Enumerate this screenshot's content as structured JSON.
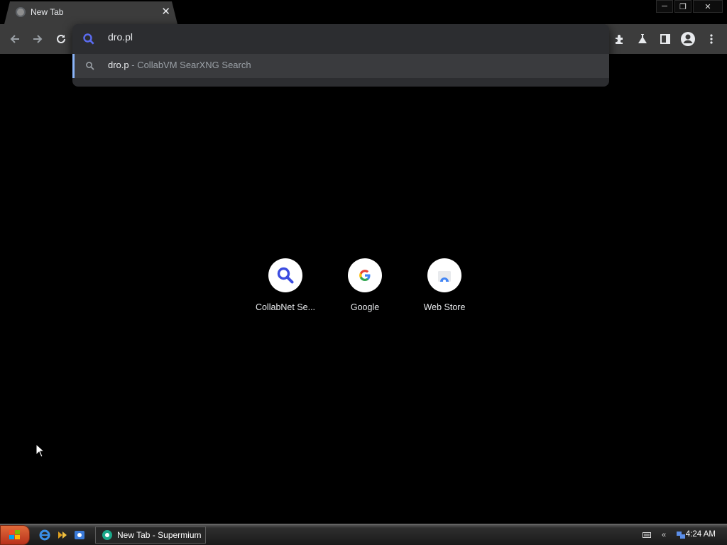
{
  "browser": {
    "tab": {
      "title": "New Tab",
      "close_glyph": "✕",
      "favicon": "globe-icon"
    },
    "window_controls": {
      "minimize": "─",
      "restore": "❐",
      "close": "✕"
    },
    "omnibox": {
      "value": "dro.pl",
      "suggestion": {
        "text": "dro.p",
        "subtext": " - CollabVM SearXNG Search"
      }
    },
    "toolbar_icons": [
      "back-icon",
      "forward-icon",
      "reload-icon",
      "extensions-icon",
      "labs-icon",
      "side-panel-icon",
      "profile-icon",
      "menu-icon"
    ]
  },
  "ntp": {
    "shortcuts": [
      {
        "label": "CollabNet Se...",
        "icon": "search-icon"
      },
      {
        "label": "Google",
        "icon": "google-icon"
      },
      {
        "label": "Web Store",
        "icon": "web-store-icon"
      }
    ]
  },
  "taskbar": {
    "task": {
      "label": "New Tab - Supermium"
    },
    "clock": "4:24 AM",
    "tray_chevron": "«"
  },
  "colors": {
    "accent": "#8ab4f8",
    "toolbar": "#3c3c3c",
    "omnibox": "#2c2d30",
    "background": "#000000"
  }
}
